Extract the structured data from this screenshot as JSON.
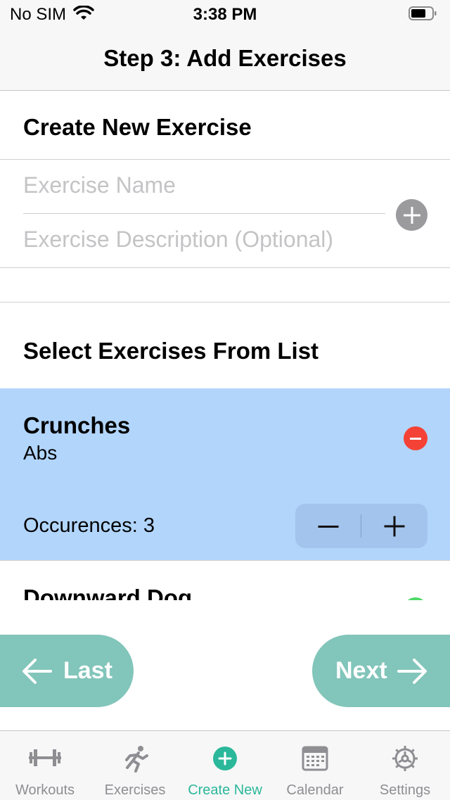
{
  "status_bar": {
    "carrier": "No SIM",
    "time": "3:38 PM"
  },
  "nav": {
    "title": "Step 3: Add Exercises"
  },
  "create": {
    "heading": "Create New Exercise",
    "name_placeholder": "Exercise Name",
    "description_placeholder": "Exercise Description (Optional)",
    "add_icon": "plus-circle-icon"
  },
  "select": {
    "heading": "Select Exercises From List",
    "items": [
      {
        "name": "Crunches",
        "category": "Abs",
        "occurrences_label": "Occurences: 3",
        "selected": true
      },
      {
        "name": "Downward Dog",
        "category": "",
        "selected": false
      }
    ]
  },
  "buttons": {
    "last": "Last",
    "next": "Next"
  },
  "tabs": [
    {
      "label": "Workouts",
      "icon": "dumbbell-icon"
    },
    {
      "label": "Exercises",
      "icon": "running-icon"
    },
    {
      "label": "Create New",
      "icon": "plus-circle-icon",
      "active": true
    },
    {
      "label": "Calendar",
      "icon": "calendar-icon"
    },
    {
      "label": "Settings",
      "icon": "gear-icon"
    }
  ],
  "colors": {
    "selected_row": "#b2d5fc",
    "button": "#82c5ba",
    "active_tab": "#2bb89a",
    "remove": "#f44336",
    "add": "#9b9b9e"
  }
}
